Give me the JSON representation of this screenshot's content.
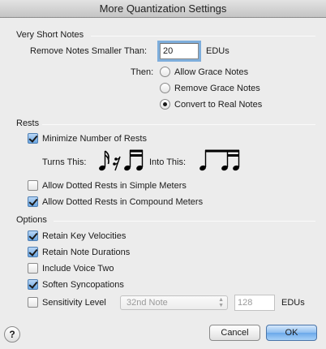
{
  "window": {
    "title": "More Quantization Settings"
  },
  "short_notes": {
    "section_label": "Very Short Notes",
    "remove_label": "Remove Notes Smaller Than:",
    "remove_value": "20",
    "remove_unit": "EDUs",
    "then_label": "Then:",
    "options": [
      {
        "label": "Allow Grace Notes",
        "selected": false
      },
      {
        "label": "Remove Grace Notes",
        "selected": false
      },
      {
        "label": "Convert to Real Notes",
        "selected": true
      }
    ]
  },
  "rests": {
    "section_label": "Rests",
    "minimize": {
      "label": "Minimize Number of Rests",
      "checked": true
    },
    "turns_this_label": "Turns This:",
    "into_this_label": "Into This:",
    "dotted_simple": {
      "label": "Allow Dotted Rests in Simple Meters",
      "checked": false
    },
    "dotted_compound": {
      "label": "Allow Dotted Rests in Compound Meters",
      "checked": true
    }
  },
  "options": {
    "section_label": "Options",
    "retain_velocities": {
      "label": "Retain Key Velocities",
      "checked": true
    },
    "retain_durations": {
      "label": "Retain Note Durations",
      "checked": true
    },
    "voice_two": {
      "label": "Include Voice Two",
      "checked": false
    },
    "soften_syncopations": {
      "label": "Soften Syncopations",
      "checked": true
    },
    "sensitivity": {
      "label": "Sensitivity Level",
      "checked": false,
      "select_value": "32nd Note",
      "edu_value": "128",
      "edu_unit": "EDUs"
    }
  },
  "buttons": {
    "cancel": "Cancel",
    "ok": "OK",
    "help": "?"
  },
  "colors": {
    "accent": "#6aa8ea",
    "focus_ring": "#7eaedc",
    "background": "#ececec"
  }
}
